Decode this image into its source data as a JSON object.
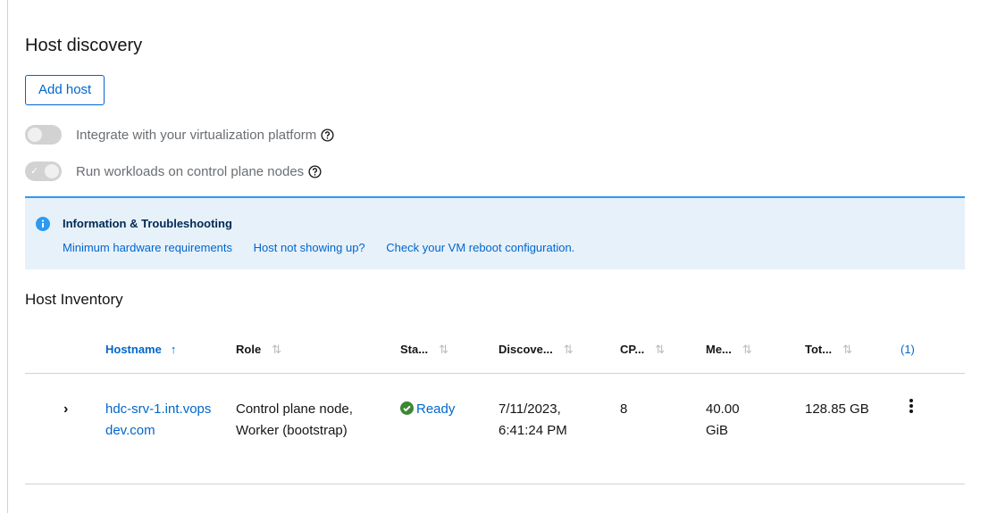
{
  "host_discovery": {
    "title": "Host discovery",
    "add_host_label": "Add host",
    "toggles": [
      {
        "label": "Integrate with your virtualization platform",
        "checked": false
      },
      {
        "label": "Run workloads on control plane nodes",
        "checked": true
      }
    ]
  },
  "alert": {
    "title": "Information & Troubleshooting",
    "links": [
      "Minimum hardware requirements",
      "Host not showing up?",
      "Check your VM reboot configuration."
    ]
  },
  "inventory": {
    "title": "Host Inventory",
    "columns": [
      "Hostname",
      "Role",
      "Sta...",
      "Discove...",
      "CP...",
      "Me...",
      "Tot...",
      "(1)"
    ],
    "sort_up_glyph": "↑",
    "sort_glyph": "⇅",
    "rows": [
      {
        "expand_glyph": "›",
        "hostname": "hdc-srv-1.int.vopsdev.com",
        "role": "Control plane node, Worker (bootstrap)",
        "status": "Ready",
        "discovered": "7/11/2023, 6:41:24 PM",
        "cpu": "8",
        "memory": "40.00 GiB",
        "total": "128.85 GB"
      }
    ]
  },
  "colors": {
    "accent": "#0066cc",
    "success": "#3e8635",
    "alert_bg": "#e7f1fa",
    "alert_border": "#2b9af3"
  },
  "icons": {
    "help": "help-circle-icon",
    "info": "info-circle-icon",
    "status_ok": "check-circle-icon",
    "row_menu": "kebab-icon"
  }
}
